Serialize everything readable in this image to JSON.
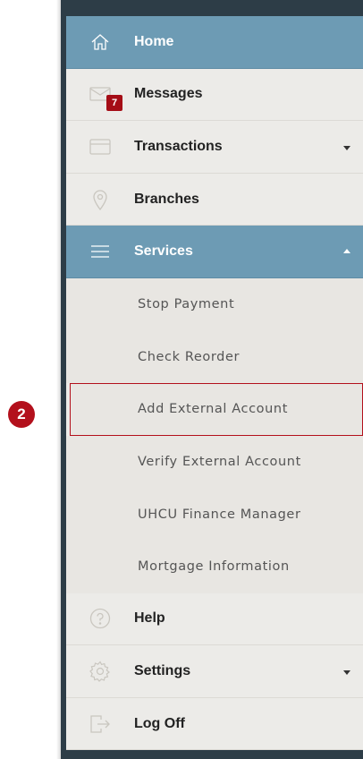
{
  "step_marker": "2",
  "nav": {
    "items": [
      {
        "label": "Home",
        "icon": "home-icon",
        "active": true
      },
      {
        "label": "Messages",
        "icon": "envelope-icon",
        "badge": "7"
      },
      {
        "label": "Transactions",
        "icon": "credit-card-icon",
        "caret": "down"
      },
      {
        "label": "Branches",
        "icon": "map-pin-icon"
      },
      {
        "label": "Services",
        "icon": "menu-icon",
        "active": true,
        "caret": "up"
      }
    ],
    "services_submenu": [
      "Stop Payment",
      "Check Reorder",
      "Add External Account",
      "Verify External Account",
      "UHCU Finance Manager",
      "Mortgage Information"
    ],
    "bottom_items": [
      {
        "label": "Help",
        "icon": "help-icon"
      },
      {
        "label": "Settings",
        "icon": "gear-icon",
        "caret": "down"
      },
      {
        "label": "Log Off",
        "icon": "log-off-icon"
      }
    ]
  },
  "colors": {
    "active_bg": "#6d9bb4",
    "menu_bg": "#ecebe8",
    "frame_bg": "#2d3d47",
    "accent_red": "#b3101c"
  }
}
